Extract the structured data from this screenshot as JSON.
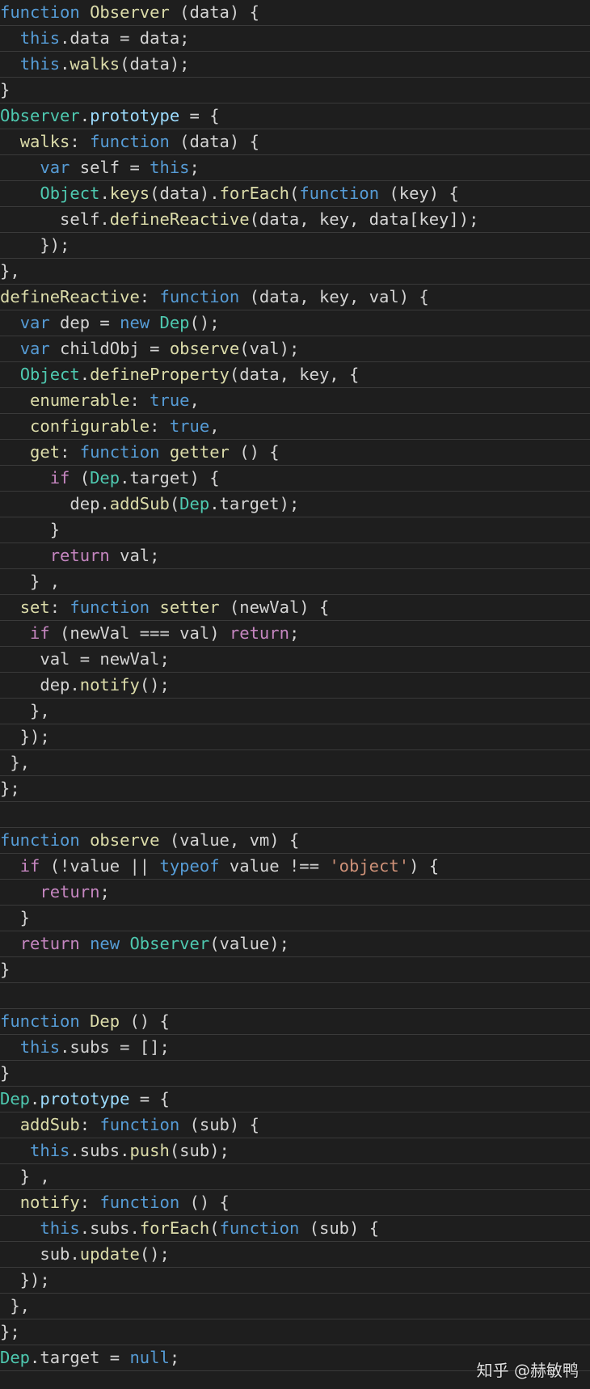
{
  "theme": {
    "background": "#1e1e1e",
    "line_separator": "#3a3a3a",
    "colors": {
      "keyword": "#569cd6",
      "control": "#c586c0",
      "function_name": "#dcdcaa",
      "class": "#4ec9b0",
      "property": "#9cdcfe",
      "string": "#ce9178",
      "plain": "#d4d4d4"
    }
  },
  "code": {
    "lines": [
      [
        [
          "kw",
          "function"
        ],
        [
          "plain",
          " "
        ],
        [
          "fn",
          "Observer"
        ],
        [
          "plain",
          " (data) {"
        ]
      ],
      [
        [
          "plain",
          "  "
        ],
        [
          "kw",
          "this"
        ],
        [
          "plain",
          ".data = data;"
        ]
      ],
      [
        [
          "plain",
          "  "
        ],
        [
          "kw",
          "this"
        ],
        [
          "plain",
          "."
        ],
        [
          "fn",
          "walks"
        ],
        [
          "plain",
          "(data);"
        ]
      ],
      [
        [
          "plain",
          "}"
        ]
      ],
      [
        [
          "cls",
          "Observer"
        ],
        [
          "plain",
          "."
        ],
        [
          "prop",
          "prototype"
        ],
        [
          "plain",
          " = {"
        ]
      ],
      [
        [
          "plain",
          "  "
        ],
        [
          "fn",
          "walks"
        ],
        [
          "plain",
          ": "
        ],
        [
          "kw",
          "function"
        ],
        [
          "plain",
          " (data) {"
        ]
      ],
      [
        [
          "plain",
          "    "
        ],
        [
          "kw",
          "var"
        ],
        [
          "plain",
          " self = "
        ],
        [
          "kw",
          "this"
        ],
        [
          "plain",
          ";"
        ]
      ],
      [
        [
          "plain",
          "    "
        ],
        [
          "cls",
          "Object"
        ],
        [
          "plain",
          "."
        ],
        [
          "fn",
          "keys"
        ],
        [
          "plain",
          "(data)."
        ],
        [
          "fn",
          "forEach"
        ],
        [
          "plain",
          "("
        ],
        [
          "kw",
          "function"
        ],
        [
          "plain",
          " (key) {"
        ]
      ],
      [
        [
          "plain",
          "      self."
        ],
        [
          "fn",
          "defineReactive"
        ],
        [
          "plain",
          "(data, key, data[key]);"
        ]
      ],
      [
        [
          "plain",
          "    });"
        ]
      ],
      [
        [
          "plain",
          "},"
        ]
      ],
      [
        [
          "fn",
          "defineReactive"
        ],
        [
          "plain",
          ": "
        ],
        [
          "kw",
          "function"
        ],
        [
          "plain",
          " (data, key, val) {"
        ]
      ],
      [
        [
          "plain",
          "  "
        ],
        [
          "kw",
          "var"
        ],
        [
          "plain",
          " dep = "
        ],
        [
          "kw",
          "new"
        ],
        [
          "plain",
          " "
        ],
        [
          "cls",
          "Dep"
        ],
        [
          "plain",
          "();"
        ]
      ],
      [
        [
          "plain",
          "  "
        ],
        [
          "kw",
          "var"
        ],
        [
          "plain",
          " childObj = "
        ],
        [
          "fn",
          "observe"
        ],
        [
          "plain",
          "(val);"
        ]
      ],
      [
        [
          "plain",
          "  "
        ],
        [
          "cls",
          "Object"
        ],
        [
          "plain",
          "."
        ],
        [
          "fn",
          "defineProperty"
        ],
        [
          "plain",
          "(data, key, {"
        ]
      ],
      [
        [
          "plain",
          "   "
        ],
        [
          "fn",
          "enumerable"
        ],
        [
          "plain",
          ": "
        ],
        [
          "kw",
          "true"
        ],
        [
          "plain",
          ","
        ]
      ],
      [
        [
          "plain",
          "   "
        ],
        [
          "fn",
          "configurable"
        ],
        [
          "plain",
          ": "
        ],
        [
          "kw",
          "true"
        ],
        [
          "plain",
          ","
        ]
      ],
      [
        [
          "plain",
          "   "
        ],
        [
          "fn",
          "get"
        ],
        [
          "plain",
          ": "
        ],
        [
          "kw",
          "function"
        ],
        [
          "plain",
          " "
        ],
        [
          "fn",
          "getter"
        ],
        [
          "plain",
          " () {"
        ]
      ],
      [
        [
          "plain",
          "     "
        ],
        [
          "ctrl",
          "if"
        ],
        [
          "plain",
          " ("
        ],
        [
          "cls",
          "Dep"
        ],
        [
          "plain",
          ".target) {"
        ]
      ],
      [
        [
          "plain",
          "       dep."
        ],
        [
          "fn",
          "addSub"
        ],
        [
          "plain",
          "("
        ],
        [
          "cls",
          "Dep"
        ],
        [
          "plain",
          ".target);"
        ]
      ],
      [
        [
          "plain",
          "     }"
        ]
      ],
      [
        [
          "plain",
          "     "
        ],
        [
          "ctrl",
          "return"
        ],
        [
          "plain",
          " val;"
        ]
      ],
      [
        [
          "plain",
          "   } ,"
        ]
      ],
      [
        [
          "plain",
          "  "
        ],
        [
          "fn",
          "set"
        ],
        [
          "plain",
          ": "
        ],
        [
          "kw",
          "function"
        ],
        [
          "plain",
          " "
        ],
        [
          "fn",
          "setter"
        ],
        [
          "plain",
          " (newVal) {"
        ]
      ],
      [
        [
          "plain",
          "   "
        ],
        [
          "ctrl",
          "if"
        ],
        [
          "plain",
          " (newVal === val) "
        ],
        [
          "ctrl",
          "return"
        ],
        [
          "plain",
          ";"
        ]
      ],
      [
        [
          "plain",
          "    val = newVal;"
        ]
      ],
      [
        [
          "plain",
          "    dep."
        ],
        [
          "fn",
          "notify"
        ],
        [
          "plain",
          "();"
        ]
      ],
      [
        [
          "plain",
          "   },"
        ]
      ],
      [
        [
          "plain",
          "  });"
        ]
      ],
      [
        [
          "plain",
          " },"
        ]
      ],
      [
        [
          "plain",
          "};"
        ]
      ],
      [],
      [
        [
          "kw",
          "function"
        ],
        [
          "plain",
          " "
        ],
        [
          "fn",
          "observe"
        ],
        [
          "plain",
          " (value, vm) {"
        ]
      ],
      [
        [
          "plain",
          "  "
        ],
        [
          "ctrl",
          "if"
        ],
        [
          "plain",
          " (!value || "
        ],
        [
          "kw",
          "typeof"
        ],
        [
          "plain",
          " value !== "
        ],
        [
          "str",
          "'object'"
        ],
        [
          "plain",
          ") {"
        ]
      ],
      [
        [
          "plain",
          "    "
        ],
        [
          "ctrl",
          "return"
        ],
        [
          "plain",
          ";"
        ]
      ],
      [
        [
          "plain",
          "  }"
        ]
      ],
      [
        [
          "plain",
          "  "
        ],
        [
          "ctrl",
          "return"
        ],
        [
          "plain",
          " "
        ],
        [
          "kw",
          "new"
        ],
        [
          "plain",
          " "
        ],
        [
          "cls",
          "Observer"
        ],
        [
          "plain",
          "(value);"
        ]
      ],
      [
        [
          "plain",
          "}"
        ]
      ],
      [],
      [
        [
          "kw",
          "function"
        ],
        [
          "plain",
          " "
        ],
        [
          "fn",
          "Dep"
        ],
        [
          "plain",
          " () {"
        ]
      ],
      [
        [
          "plain",
          "  "
        ],
        [
          "kw",
          "this"
        ],
        [
          "plain",
          ".subs = [];"
        ]
      ],
      [
        [
          "plain",
          "}"
        ]
      ],
      [
        [
          "cls",
          "Dep"
        ],
        [
          "plain",
          "."
        ],
        [
          "prop",
          "prototype"
        ],
        [
          "plain",
          " = {"
        ]
      ],
      [
        [
          "plain",
          "  "
        ],
        [
          "fn",
          "addSub"
        ],
        [
          "plain",
          ": "
        ],
        [
          "kw",
          "function"
        ],
        [
          "plain",
          " (sub) {"
        ]
      ],
      [
        [
          "plain",
          "   "
        ],
        [
          "kw",
          "this"
        ],
        [
          "plain",
          ".subs."
        ],
        [
          "fn",
          "push"
        ],
        [
          "plain",
          "(sub);"
        ]
      ],
      [
        [
          "plain",
          "  } ,"
        ]
      ],
      [
        [
          "plain",
          "  "
        ],
        [
          "fn",
          "notify"
        ],
        [
          "plain",
          ": "
        ],
        [
          "kw",
          "function"
        ],
        [
          "plain",
          " () {"
        ]
      ],
      [
        [
          "plain",
          "    "
        ],
        [
          "kw",
          "this"
        ],
        [
          "plain",
          ".subs."
        ],
        [
          "fn",
          "forEach"
        ],
        [
          "plain",
          "("
        ],
        [
          "kw",
          "function"
        ],
        [
          "plain",
          " (sub) {"
        ]
      ],
      [
        [
          "plain",
          "    sub."
        ],
        [
          "fn",
          "update"
        ],
        [
          "plain",
          "();"
        ]
      ],
      [
        [
          "plain",
          "  });"
        ]
      ],
      [
        [
          "plain",
          " },"
        ]
      ],
      [
        [
          "plain",
          "};"
        ]
      ],
      [
        [
          "cls",
          "Dep"
        ],
        [
          "plain",
          ".target = "
        ],
        [
          "kw",
          "null"
        ],
        [
          "plain",
          ";"
        ]
      ]
    ]
  },
  "watermark": {
    "text": "知乎 @赫敏鸭"
  }
}
